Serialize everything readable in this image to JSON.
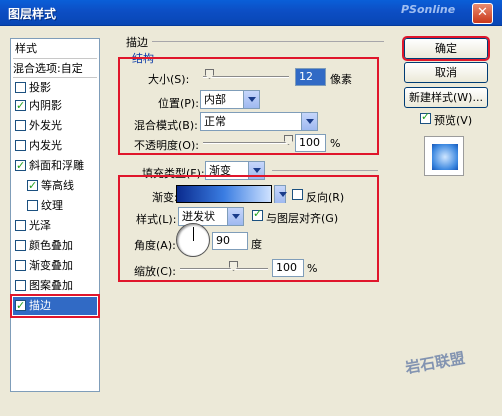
{
  "window": {
    "title": "图层样式",
    "watermark_top": "PSonline"
  },
  "sidebar": {
    "header": "样式",
    "blend_options": "混合选项:自定",
    "items": [
      {
        "label": "投影",
        "checked": false
      },
      {
        "label": "内阴影",
        "checked": true
      },
      {
        "label": "外发光",
        "checked": false
      },
      {
        "label": "内发光",
        "checked": false
      },
      {
        "label": "斜面和浮雕",
        "checked": true
      },
      {
        "label": "等高线",
        "checked": true
      },
      {
        "label": "纹理",
        "checked": false
      },
      {
        "label": "光泽",
        "checked": false
      },
      {
        "label": "颜色叠加",
        "checked": false
      },
      {
        "label": "渐变叠加",
        "checked": false
      },
      {
        "label": "图案叠加",
        "checked": false
      },
      {
        "label": "描边",
        "checked": true
      }
    ]
  },
  "stroke": {
    "section_title": "描边",
    "structure_title": "结构",
    "size_label": "大小(S):",
    "size_value": "12",
    "size_unit": "像素",
    "position_label": "位置(P):",
    "position_value": "内部",
    "blend_label": "混合模式(B):",
    "blend_value": "正常",
    "opacity_label": "不透明度(O):",
    "opacity_value": "100",
    "opacity_unit": "%",
    "fill_type_label": "填充类型(F):",
    "fill_type_value": "渐变",
    "gradient_label": "渐变:",
    "reverse_label": "反向(R)",
    "style_label": "样式(L):",
    "style_value": "迸发状",
    "align_label": "与图层对齐(G)",
    "angle_label": "角度(A):",
    "angle_value": "90",
    "angle_unit": "度",
    "scale_label": "缩放(C):",
    "scale_value": "100",
    "scale_unit": "%"
  },
  "buttons": {
    "ok": "确定",
    "cancel": "取消",
    "new_style": "新建样式(W)...",
    "preview": "预览(V)"
  },
  "watermark_bottom": "岩石联盟"
}
